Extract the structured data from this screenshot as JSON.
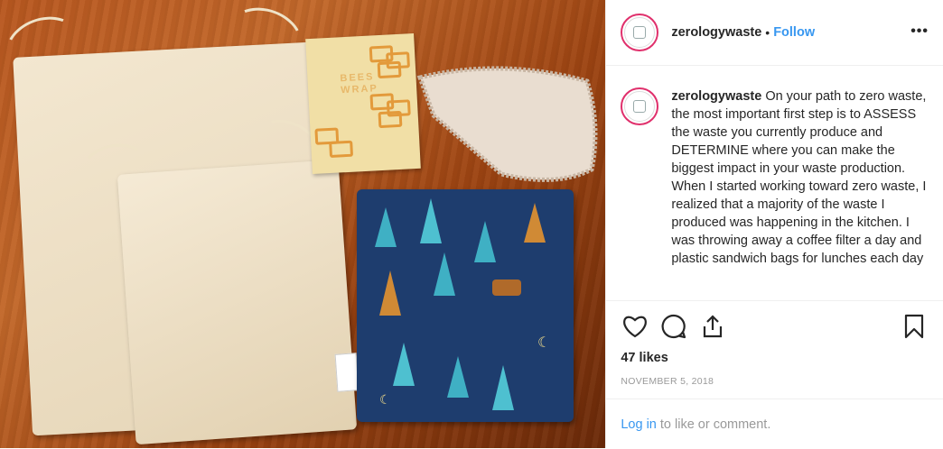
{
  "post": {
    "username": "zerologywaste",
    "separator": "•",
    "follow_label": "Follow",
    "more_label": "•••"
  },
  "caption": {
    "username": "zerologywaste",
    "paragraph1": "On your path to zero waste, the most important first step is to ASSESS the waste you currently produce and DETERMINE where you can make the biggest impact in your waste production.",
    "paragraph2": "When I started working toward zero waste, I realized that a majority of the waste I produced was happening in the kitchen. I was throwing away a coffee filter a day and plastic sandwich bags for lunches each day"
  },
  "photo": {
    "wrap_text": "BEES WRAP",
    "colors": {
      "wood": "#b8571f",
      "pouch": "#1e3d6e",
      "cotton": "#f3e7d0"
    }
  },
  "stats": {
    "likes": "47 likes",
    "date": "NOVEMBER 5, 2018"
  },
  "login": {
    "link_label": "Log in",
    "suffix": "to like or comment."
  },
  "icons": [
    "heart-icon",
    "comment-icon",
    "share-icon",
    "bookmark-icon"
  ],
  "accent": "#3897f0"
}
